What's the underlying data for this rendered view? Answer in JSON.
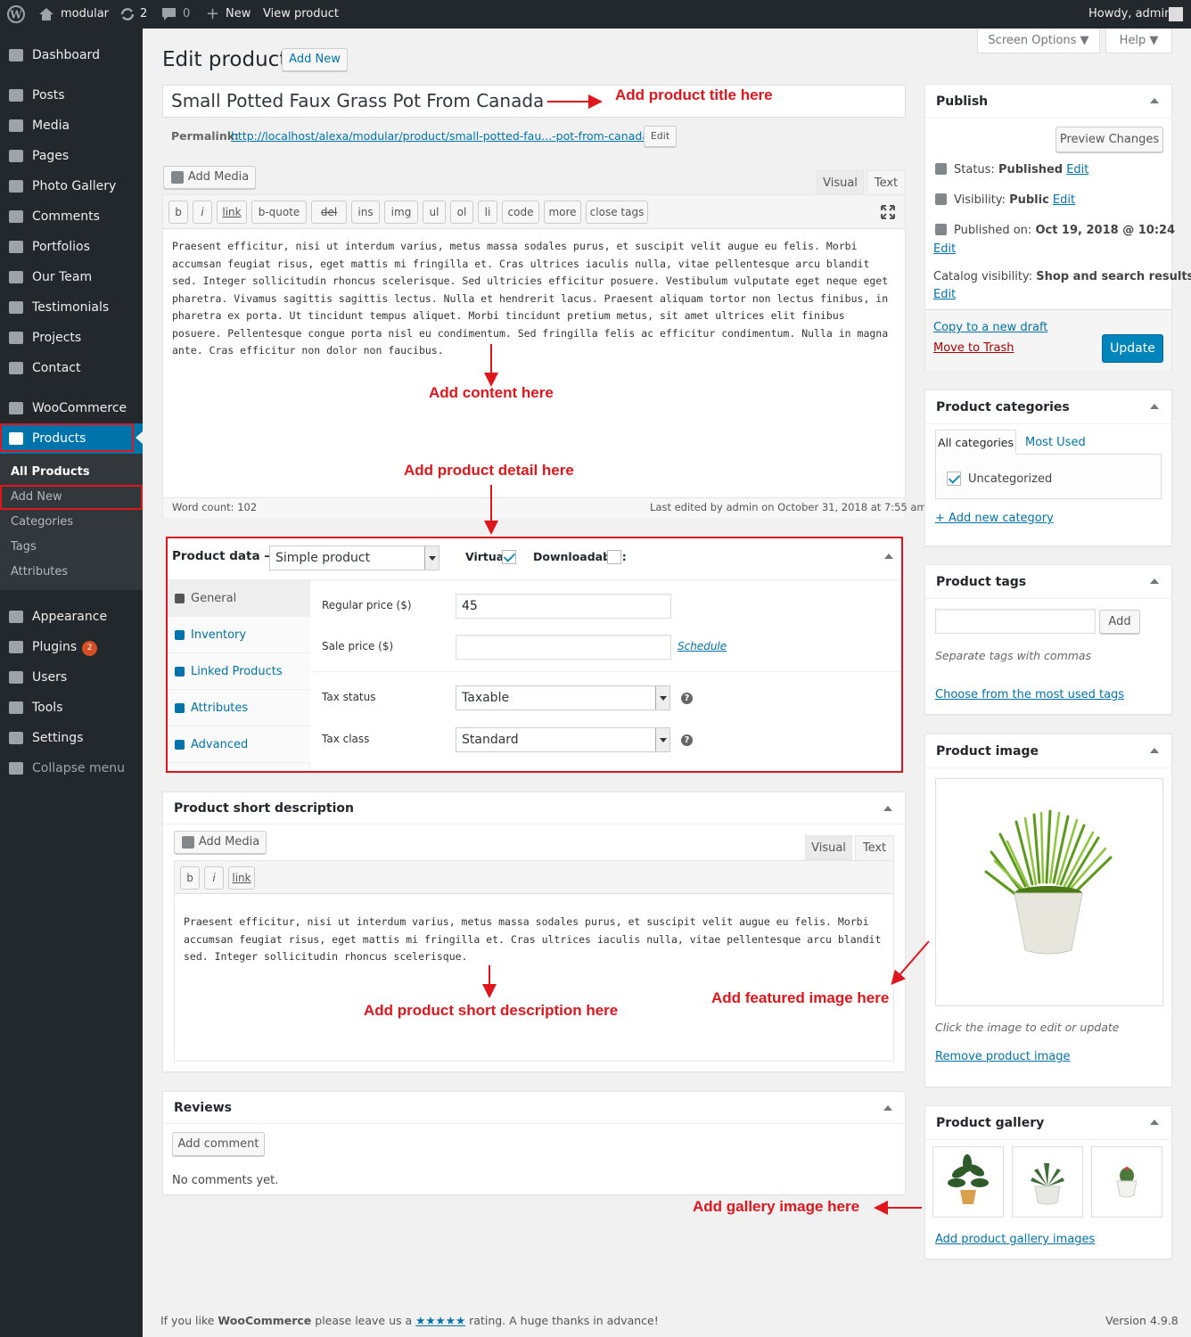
{
  "adminbar": {
    "site": "modular",
    "updates": "2",
    "comments": "0",
    "new": "New",
    "view": "View product",
    "howdy": "Howdy, admin"
  },
  "sidebar": {
    "items": [
      {
        "label": "Dashboard",
        "icon": "dashboard-icon"
      },
      {
        "label": "Posts",
        "icon": "pin-icon"
      },
      {
        "label": "Media",
        "icon": "media-icon"
      },
      {
        "label": "Pages",
        "icon": "pages-icon"
      },
      {
        "label": "Photo Gallery",
        "icon": "pin-icon"
      },
      {
        "label": "Comments",
        "icon": "comment-icon"
      },
      {
        "label": "Portfolios",
        "icon": "folder-icon"
      },
      {
        "label": "Our Team",
        "icon": "team-icon"
      },
      {
        "label": "Testimonials",
        "icon": "quote-icon"
      },
      {
        "label": "Projects",
        "icon": "list-icon"
      },
      {
        "label": "Contact",
        "icon": "mail-icon"
      },
      {
        "label": "WooCommerce",
        "icon": "woo-icon"
      },
      {
        "label": "Products",
        "icon": "cube-icon"
      },
      {
        "label": "Appearance",
        "icon": "brush-icon"
      },
      {
        "label": "Plugins",
        "icon": "plugin-icon",
        "badge": "2"
      },
      {
        "label": "Users",
        "icon": "user-icon"
      },
      {
        "label": "Tools",
        "icon": "wrench-icon"
      },
      {
        "label": "Settings",
        "icon": "settings-icon"
      },
      {
        "label": "Collapse menu",
        "icon": "collapse-icon"
      }
    ],
    "submenu": [
      "All Products",
      "Add New",
      "Categories",
      "Tags",
      "Attributes"
    ]
  },
  "header": {
    "title": "Edit product",
    "add_new": "Add New",
    "screen_options": "Screen Options",
    "help": "Help"
  },
  "editor": {
    "title_value": "Small Potted Faux Grass Pot From Canada",
    "permalink_label": "Permalink:",
    "permalink_url": "http://localhost/alexa/modular/product/small-potted-fau...-pot-from-canada/",
    "permalink_edit": "Edit",
    "add_media": "Add Media",
    "tab_visual": "Visual",
    "tab_text": "Text",
    "quicktags": [
      "b",
      "i",
      "link",
      "b-quote",
      "del",
      "ins",
      "img",
      "ul",
      "ol",
      "li",
      "code",
      "more",
      "close tags"
    ],
    "content": "Praesent efficitur, nisi ut interdum varius, metus massa sodales purus, et suscipit velit augue eu felis. Morbi accumsan feugiat risus, eget mattis mi fringilla et. Cras ultrices iaculis nulla, vitae pellentesque arcu blandit sed. Integer sollicitudin rhoncus scelerisque. Sed ultricies efficitur posuere. Vestibulum vulputate eget neque eget pharetra. Vivamus sagittis sagittis lectus. Nulla et hendrerit lacus. Praesent aliquam tortor non lectus finibus, in pharetra ex porta. Ut tincidunt tempus aliquet. Morbi tincidunt pretium metus, sit amet ultrices elit finibus posuere. Pellentesque congue porta nisl eu condimentum. Sed fringilla felis ac efficitur condimentum. Nulla in magna ante. Cras efficitur non dolor non faucibus.",
    "word_count": "Word count: 102",
    "last_edited": "Last edited by admin on October 31, 2018 at 7:55 am"
  },
  "product_data": {
    "label": "Product data —",
    "type": "Simple product",
    "virtual_label": "Virtual:",
    "virtual": true,
    "downloadable_label": "Downloadable:",
    "downloadable": false,
    "tabs": [
      "General",
      "Inventory",
      "Linked Products",
      "Attributes",
      "Advanced"
    ],
    "regular_price_label": "Regular price ($)",
    "regular_price": "45",
    "sale_price_label": "Sale price ($)",
    "sale_price": "",
    "schedule": "Schedule",
    "tax_status_label": "Tax status",
    "tax_status": "Taxable",
    "tax_class_label": "Tax class",
    "tax_class": "Standard"
  },
  "short_desc": {
    "title": "Product short description",
    "add_media": "Add Media",
    "tab_visual": "Visual",
    "tab_text": "Text",
    "quicktags": [
      "b",
      "i",
      "link"
    ],
    "content": "Praesent efficitur, nisi ut interdum varius, metus massa sodales purus, et suscipit velit augue eu felis. Morbi accumsan feugiat risus, eget mattis mi fringilla et. Cras ultrices iaculis nulla, vitae pellentesque arcu blandit sed. Integer sollicitudin rhoncus scelerisque."
  },
  "reviews": {
    "title": "Reviews",
    "add_comment": "Add comment",
    "none": "No comments yet."
  },
  "publish": {
    "title": "Publish",
    "preview": "Preview Changes",
    "status_label": "Status:",
    "status": "Published",
    "visibility_label": "Visibility:",
    "visibility": "Public",
    "published_label": "Published on:",
    "published": "Oct 19, 2018 @ 10:24",
    "catalog_label": "Catalog visibility:",
    "catalog": "Shop and search results",
    "edit": "Edit",
    "copy": "Copy to a new draft",
    "trash": "Move to Trash",
    "update": "Update"
  },
  "categories": {
    "title": "Product categories",
    "tab_all": "All categories",
    "tab_most": "Most Used",
    "item": "Uncategorized",
    "add": "+ Add new category"
  },
  "tags": {
    "title": "Product tags",
    "add": "Add",
    "hint": "Separate tags with commas",
    "choose": "Choose from the most used tags"
  },
  "image": {
    "title": "Product image",
    "hint": "Click the image to edit or update",
    "remove": "Remove product image"
  },
  "gallery": {
    "title": "Product gallery",
    "add": "Add product gallery images"
  },
  "annotations": {
    "title": "Add product title here",
    "content": "Add content here",
    "detail": "Add product detail here",
    "short": "Add product short description here",
    "featured": "Add featured image here",
    "gallery": "Add gallery image here"
  },
  "footer": {
    "thanks_pre": "If you like",
    "thanks_brand": "WooCommerce",
    "thanks_mid": "please leave us a",
    "thanks_stars": "★★★★★",
    "thanks_post": "rating. A huge thanks in advance!",
    "version": "Version 4.9.8"
  },
  "colors": {
    "accent": "#0073aa",
    "annotation": "#e0161d",
    "adminbar": "#23282d"
  }
}
